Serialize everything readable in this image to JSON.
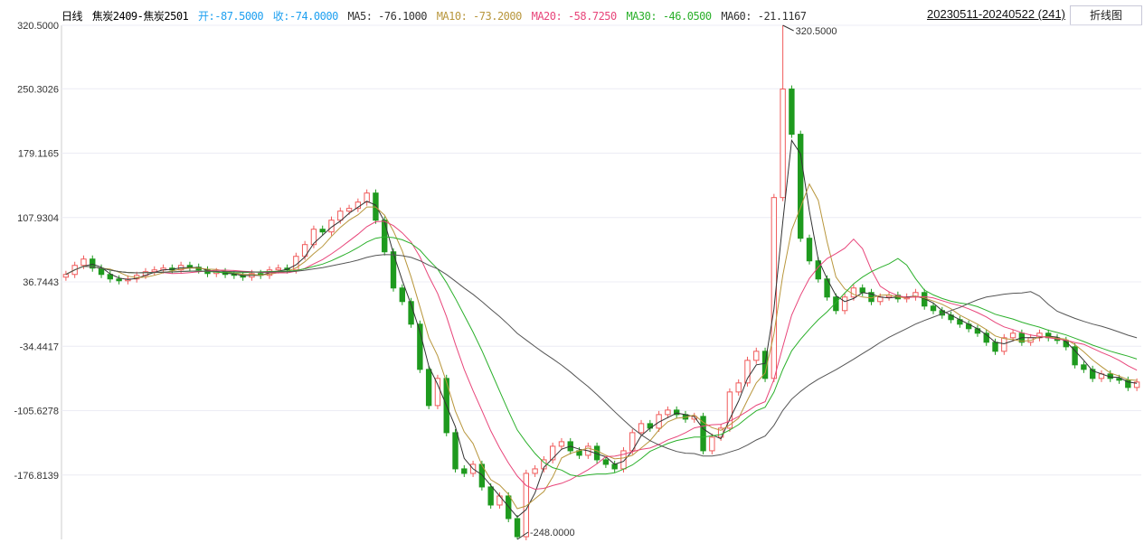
{
  "header": {
    "period": "日线",
    "symbol": "焦炭2409-焦炭2501",
    "open": "开:-87.5000",
    "close": "收:-74.0000",
    "ma5": "MA5: -76.1000",
    "ma10": "MA10: -73.2000",
    "ma20": "MA20: -58.7250",
    "ma30": "MA30: -46.0500",
    "ma60": "MA60: -21.1167",
    "date_range": "20230511-20240522 (241)",
    "line_chart_button": "折线图"
  },
  "colors": {
    "up": "#f05a5a",
    "down": "#1e9a1e",
    "ma5": "#333333",
    "ma10": "#b8963c",
    "ma20": "#e8457a",
    "ma30": "#2bb02b",
    "ma60": "#555555",
    "open": "#1ea0f0"
  },
  "chart_data": {
    "type": "candlestick",
    "title": "焦炭2409-焦炭2501",
    "ylim": [
      -248,
      320.5
    ],
    "yticks": [
      "320.5000",
      "250.3026",
      "179.1165",
      "107.9304",
      "36.7443",
      "-34.4417",
      "-105.6278",
      "-176.8139"
    ],
    "ytick_values": [
      320.5,
      250.3026,
      179.1165,
      107.9304,
      36.7443,
      -34.4417,
      -105.6278,
      -176.8139
    ],
    "grid": true,
    "close": [
      45,
      55,
      62,
      52,
      45,
      40,
      38,
      40,
      44,
      48,
      50,
      52,
      50,
      55,
      53,
      50,
      46,
      48,
      45,
      44,
      42,
      46,
      44,
      50,
      52,
      50,
      65,
      78,
      95,
      92,
      105,
      115,
      118,
      125,
      135,
      105,
      70,
      30,
      15,
      -10,
      -60,
      -100,
      -70,
      -130,
      -170,
      -175,
      -165,
      -190,
      -210,
      -200,
      -225,
      -245,
      -175,
      -170,
      -160,
      -145,
      -140,
      -150,
      -155,
      -145,
      -160,
      -165,
      -170,
      -150,
      -130,
      -120,
      -125,
      -110,
      -105,
      -110,
      -115,
      -112,
      -150,
      -135,
      -125,
      -85,
      -75,
      -50,
      -40,
      -70,
      130,
      250,
      200,
      85,
      60,
      40,
      20,
      5,
      20,
      30,
      25,
      15,
      20,
      22,
      18,
      20,
      25,
      10,
      5,
      0,
      -5,
      -10,
      -15,
      -20,
      -30,
      -40,
      -25,
      -20,
      -30,
      -25,
      -20,
      -25,
      -28,
      -35,
      -55,
      -60,
      -70,
      -65,
      -70,
      -72,
      -80,
      -74
    ],
    "annotations": [
      {
        "label": "320.5000",
        "value": 320.5,
        "type": "max"
      },
      {
        "label": "-248.0000",
        "value": -248,
        "type": "min"
      }
    ],
    "ma_periods": [
      5,
      10,
      20,
      30,
      60
    ]
  }
}
